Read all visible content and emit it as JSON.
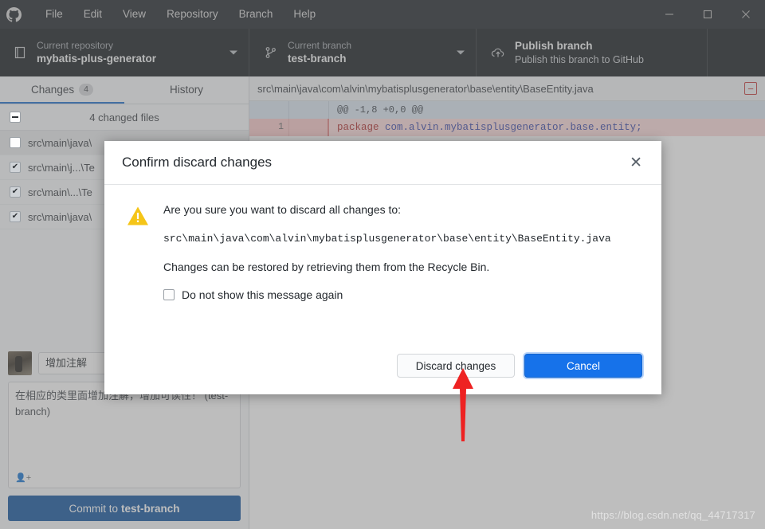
{
  "titlebar": {
    "logo_icon": "github-logo-icon",
    "menu": [
      {
        "label": "File"
      },
      {
        "label": "Edit"
      },
      {
        "label": "View"
      },
      {
        "label": "Repository"
      },
      {
        "label": "Branch"
      },
      {
        "label": "Help"
      }
    ],
    "window_controls": {
      "minimize": "minimize-icon",
      "maximize": "maximize-icon",
      "close": "close-icon"
    }
  },
  "toolbar": {
    "repository": {
      "label": "Current repository",
      "value": "mybatis-plus-generator",
      "icon": "repository-icon"
    },
    "branch": {
      "label": "Current branch",
      "value": "test-branch",
      "icon": "branch-icon"
    },
    "publish": {
      "label": "Publish branch",
      "sublabel": "Publish this branch to GitHub",
      "icon": "cloud-upload-icon"
    }
  },
  "sidebar": {
    "tabs": [
      {
        "label": "Changes",
        "badge": "4",
        "active": true
      },
      {
        "label": "History",
        "badge": "",
        "active": false
      }
    ],
    "files_header": {
      "label": "4 changed files",
      "checkbox_state": "indeterminate"
    },
    "files": [
      {
        "path": "src\\main\\java\\",
        "checked": false,
        "selected": true
      },
      {
        "path": "src\\main\\j...\\Te",
        "checked": true,
        "selected": false
      },
      {
        "path": "src\\main\\...\\Te",
        "checked": true,
        "selected": false
      },
      {
        "path": "src\\main\\java\\",
        "checked": true,
        "selected": false
      }
    ],
    "commit": {
      "summary": "增加注解",
      "description": "在相应的类里面增加注解，增加可读性！ (test-branch)",
      "coauthor_icon": "add-coauthor-icon",
      "button_prefix": "Commit to",
      "button_branch": "test-branch"
    }
  },
  "diff": {
    "file_path": "src\\main\\java\\com\\alvin\\mybatisplusgenerator\\base\\entity\\BaseEntity.java",
    "collapse_icon": "minus-box-icon",
    "hunk_header": "@@ -1,8 +0,0 @@",
    "lines": [
      {
        "number": "1",
        "type": "deleted",
        "prefix": "package",
        "text": " com.alvin.mybatisplusgenerator.base.entity;"
      }
    ]
  },
  "modal": {
    "title": "Confirm discard changes",
    "close_icon": "close-icon",
    "warning_icon": "warning-triangle-icon",
    "question": "Are you sure you want to discard all changes to:",
    "path": "src\\main\\java\\com\\alvin\\mybatisplusgenerator\\base\\entity\\BaseEntity.java",
    "note": "Changes can be restored by retrieving them from the Recycle Bin.",
    "checkbox_label": "Do not show this message again",
    "checkbox_checked": false,
    "discard_button": "Discard changes",
    "cancel_button": "Cancel"
  },
  "annotation": {
    "arrow_icon": "red-up-arrow-icon",
    "arrow_color": "#ee2222"
  },
  "watermark": {
    "text": "https://blog.csdn.net/qq_44717317"
  },
  "colors": {
    "titlebar_bg": "#24292e",
    "toolbar_bg": "#1b1f23",
    "accent_blue": "#1672ea",
    "commit_blue": "#14569f",
    "tab_underline": "#1f6fcc",
    "warning_yellow": "#f5c518",
    "delete_red": "#c33b3b"
  }
}
